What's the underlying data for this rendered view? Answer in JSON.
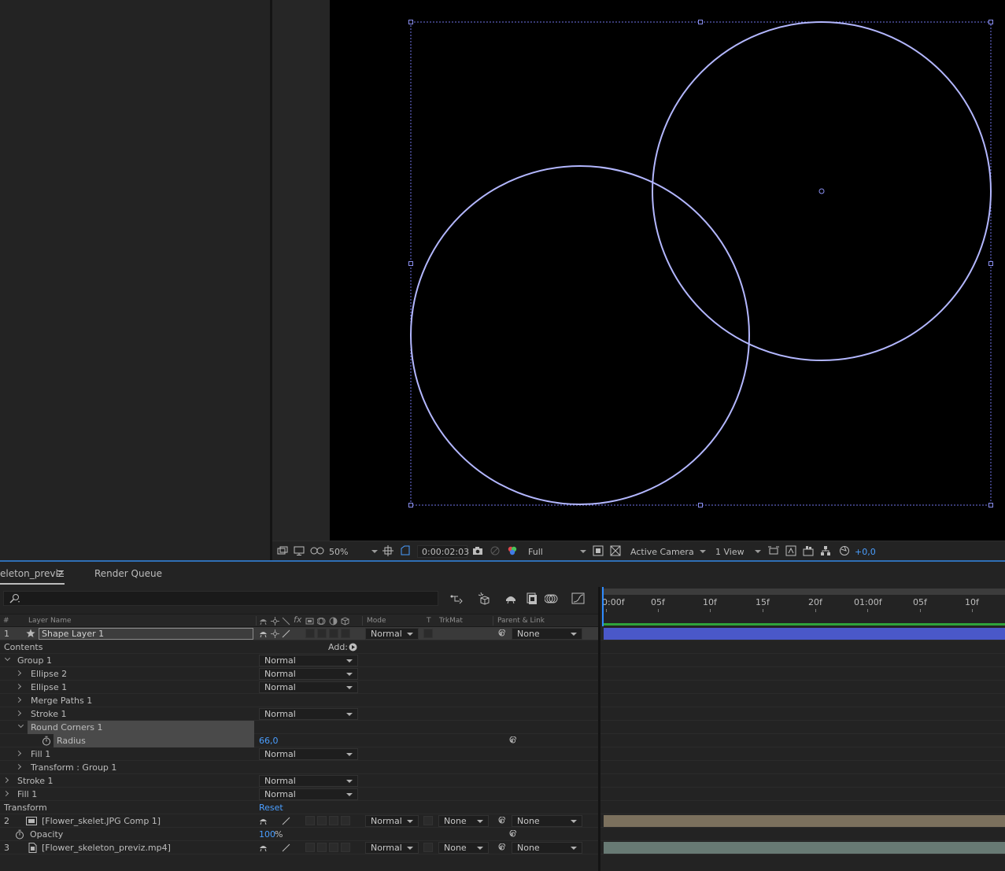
{
  "viewer": {
    "zoom": "50%",
    "timecode": "0:00:02:03",
    "resolution": "Full",
    "camera": "Active Camera",
    "views": "1 View",
    "exposure": "+0,0",
    "stroke_color": "#b3b7ff",
    "bbox_color": "#6f74e8"
  },
  "timeline": {
    "comp_tab": "eleton_previz",
    "render_tab": "Render Queue",
    "columns": {
      "num": "#",
      "layer_name": "Layer Name",
      "mode": "Mode",
      "t": "T",
      "trkmat": "TrkMat",
      "parent": "Parent & Link"
    },
    "ruler": [
      "0:00f",
      "05f",
      "10f",
      "15f",
      "20f",
      "01:00f",
      "05f",
      "10f"
    ],
    "layer1": {
      "num": "1",
      "name": "Shape Layer 1",
      "mode": "Normal",
      "parent": "None",
      "bar_color": "#4a58c9"
    },
    "contents": {
      "label": "Contents",
      "add": "Add:"
    },
    "group1": {
      "label": "Group 1",
      "mode": "Normal"
    },
    "ellipse2": {
      "label": "Ellipse 2",
      "mode": "Normal"
    },
    "ellipse1": {
      "label": "Ellipse 1",
      "mode": "Normal"
    },
    "merge": {
      "label": "Merge Paths 1"
    },
    "stroke1_inner": {
      "label": "Stroke 1",
      "mode": "Normal"
    },
    "round": {
      "label": "Round Corners 1"
    },
    "radius": {
      "label": "Radius",
      "value": "66,0"
    },
    "fill1_inner": {
      "label": "Fill 1",
      "mode": "Normal"
    },
    "transform_group": {
      "label": "Transform : Group 1"
    },
    "stroke1": {
      "label": "Stroke 1",
      "mode": "Normal"
    },
    "fill1": {
      "label": "Fill 1",
      "mode": "Normal"
    },
    "transform": {
      "label": "Transform",
      "reset": "Reset"
    },
    "layer2": {
      "num": "2",
      "name": "[Flower_skelet.JPG Comp 1]",
      "mode": "Normal",
      "trkmat": "None",
      "parent": "None",
      "bar_color": "#7b705d"
    },
    "opacity": {
      "label": "Opacity",
      "value": "100",
      "unit": "%"
    },
    "layer3": {
      "num": "3",
      "name": "[Flower_skeleton_previz.mp4]",
      "mode": "Normal",
      "trkmat": "None",
      "parent": "None",
      "bar_color": "#687a74"
    }
  }
}
